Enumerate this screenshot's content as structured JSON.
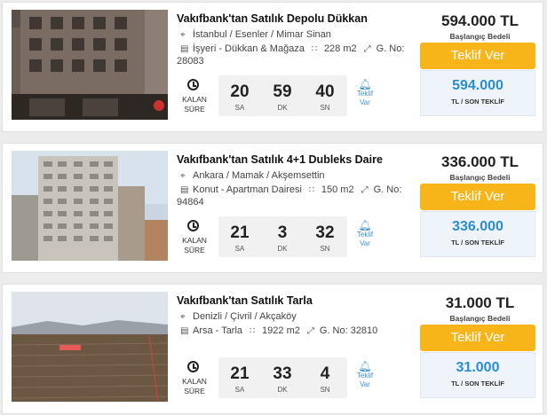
{
  "listings": [
    {
      "title": "Vakıfbank'tan Satılık Depolu Dükkan",
      "location": "İstanbul / Esenler / Mimar Sinan",
      "category": "İşyeri - Dükkan & Mağaza",
      "area": "228 m2",
      "gno_label": "G. No:",
      "gno_value": "28083",
      "timer_label": "KALAN SÜRE",
      "countdown": [
        {
          "value": "20",
          "unit": "SA"
        },
        {
          "value": "59",
          "unit": "DK"
        },
        {
          "value": "40",
          "unit": "SN"
        }
      ],
      "notify_label": "Teklif Var",
      "start_price": "594.000 TL",
      "start_price_label": "Başlangıç Bedeli",
      "bid_button": "Teklif Ver",
      "last_price": "594.000",
      "last_price_label": "TL / SON TEKLİF"
    },
    {
      "title": "Vakıfbank'tan Satılık 4+1 Dubleks Daire",
      "location": "Ankara / Mamak / Akşemsettin",
      "category": "Konut - Apartman Dairesi",
      "area": "150 m2",
      "gno_label": "G. No:",
      "gno_value": "94864",
      "timer_label": "KALAN SÜRE",
      "countdown": [
        {
          "value": "21",
          "unit": "SA"
        },
        {
          "value": "3",
          "unit": "DK"
        },
        {
          "value": "32",
          "unit": "SN"
        }
      ],
      "notify_label": "Teklif Var",
      "start_price": "336.000 TL",
      "start_price_label": "Başlangıç Bedeli",
      "bid_button": "Teklif Ver",
      "last_price": "336.000",
      "last_price_label": "TL / SON TEKLİF"
    },
    {
      "title": "Vakıfbank'tan Satılık Tarla",
      "location": "Denizli / Çivril / Akçaköy",
      "category": "Arsa - Tarla",
      "area": "1922 m2",
      "gno_label": "G. No: 32810",
      "gno_value": "",
      "timer_label": "KALAN SÜRE",
      "countdown": [
        {
          "value": "21",
          "unit": "SA"
        },
        {
          "value": "33",
          "unit": "DK"
        },
        {
          "value": "4",
          "unit": "SN"
        }
      ],
      "notify_label": "Teklif Var",
      "start_price": "31.000 TL",
      "start_price_label": "Başlangıç Bedeli",
      "bid_button": "Teklif Ver",
      "last_price": "31.000",
      "last_price_label": "TL / SON TEKLİF"
    }
  ],
  "icons": {
    "location": "map-pin-icon",
    "category": "building-icon",
    "area": "area-icon",
    "gno": "expand-icon",
    "timer": "clock-icon",
    "notify": "bell-icon"
  },
  "colors": {
    "bid_button": "#f7b51a",
    "last_price": "#2a8fce",
    "notify": "#3e92cf"
  }
}
